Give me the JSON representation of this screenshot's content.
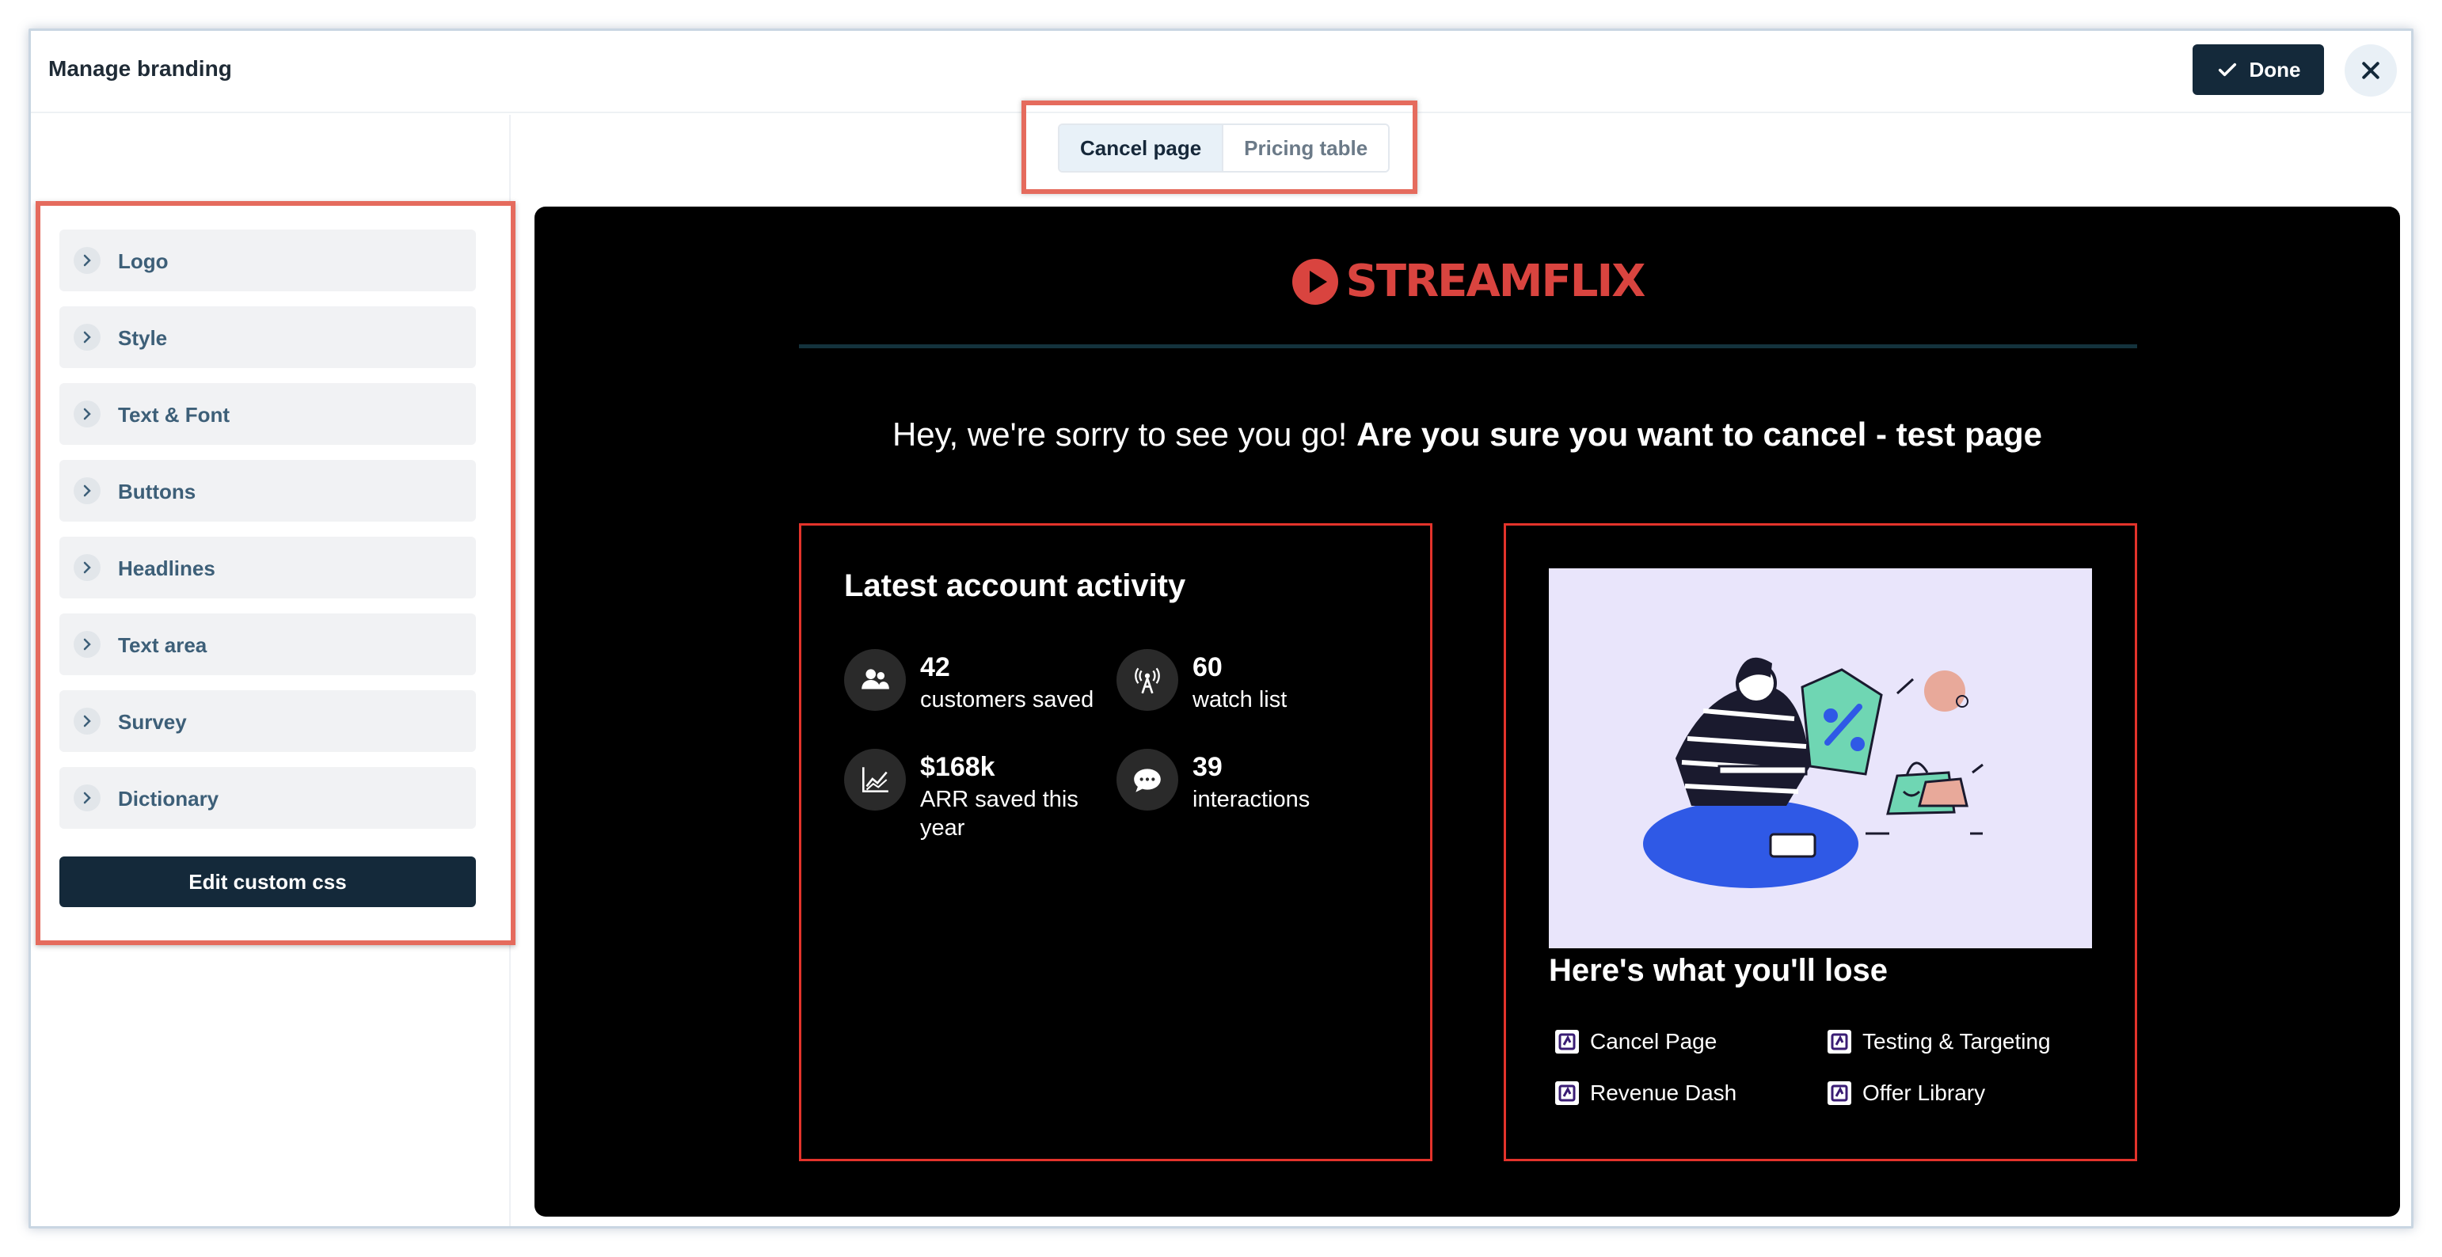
{
  "header": {
    "title": "Manage branding",
    "done_label": "Done"
  },
  "tabs": [
    {
      "label": "Cancel page",
      "active": true
    },
    {
      "label": "Pricing table",
      "active": false
    }
  ],
  "sidebar": {
    "items": [
      {
        "label": "Logo"
      },
      {
        "label": "Style"
      },
      {
        "label": "Text & Font"
      },
      {
        "label": "Buttons"
      },
      {
        "label": "Headlines"
      },
      {
        "label": "Text area"
      },
      {
        "label": "Survey"
      },
      {
        "label": "Dictionary"
      }
    ],
    "custom_css_label": "Edit custom css"
  },
  "preview": {
    "logo_text": "STREAMFLIX",
    "headline_regular": "Hey, we're sorry to see you go! ",
    "headline_bold": "Are you sure you want to cancel - test page",
    "activity": {
      "title": "Latest account activity",
      "stats": [
        {
          "value": "42",
          "label": "customers saved",
          "icon": "users-icon"
        },
        {
          "value": "60",
          "label": "watch list",
          "icon": "broadcast-tower-icon"
        },
        {
          "value": "$168k",
          "label": "ARR saved this year",
          "icon": "chart-line-icon"
        },
        {
          "value": "39",
          "label": "interactions",
          "icon": "chat-bubble-icon"
        }
      ]
    },
    "lose": {
      "title": "Here's what you'll lose",
      "features": [
        {
          "label": "Cancel Page"
        },
        {
          "label": "Testing & Targeting"
        },
        {
          "label": "Revenue Dash"
        },
        {
          "label": "Offer Library"
        }
      ]
    }
  },
  "colors": {
    "primary_dark": "#14293a",
    "highlight_red": "#e56b5d",
    "brand_red": "#d9443f",
    "card_border": "#e3332b",
    "illustration_bg": "#e9e5fb"
  }
}
